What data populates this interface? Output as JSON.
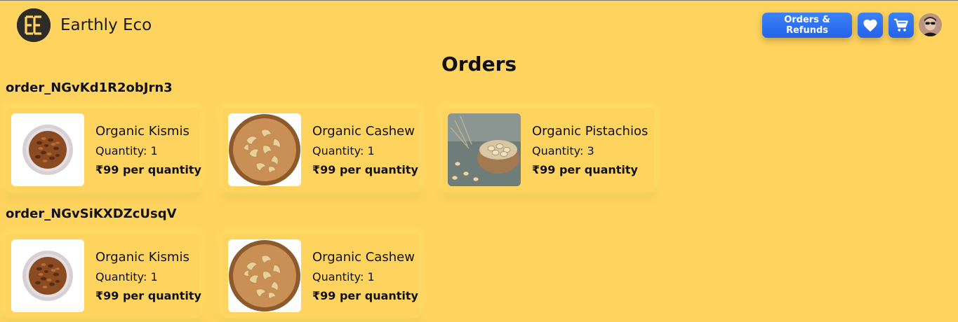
{
  "header": {
    "brand": "Earthly Eco",
    "logo_text": "EE",
    "orders_button": "Orders & Refunds",
    "wishlist_icon": "heart-icon",
    "cart_icon": "cart-icon",
    "accent": "#2563eb",
    "background": "#FFD45E"
  },
  "page": {
    "title": "Orders"
  },
  "orders": [
    {
      "id": "order_NGvKd1R2obJrn3",
      "items": [
        {
          "name": "Organic Kismis",
          "quantity": "Quantity: 1",
          "price": "₹99 per quantity",
          "image": "kismis"
        },
        {
          "name": "Organic Cashew",
          "quantity": "Quantity: 1",
          "price": "₹99 per quantity",
          "image": "cashew"
        },
        {
          "name": "Organic Pistachios",
          "quantity": "Quantity: 3",
          "price": "₹99 per quantity",
          "image": "pistachio"
        }
      ]
    },
    {
      "id": "order_NGvSiKXDZcUsqV",
      "items": [
        {
          "name": "Organic Kismis",
          "quantity": "Quantity: 1",
          "price": "₹99 per quantity",
          "image": "kismis"
        },
        {
          "name": "Organic Cashew",
          "quantity": "Quantity: 1",
          "price": "₹99 per quantity",
          "image": "cashew"
        }
      ]
    }
  ]
}
